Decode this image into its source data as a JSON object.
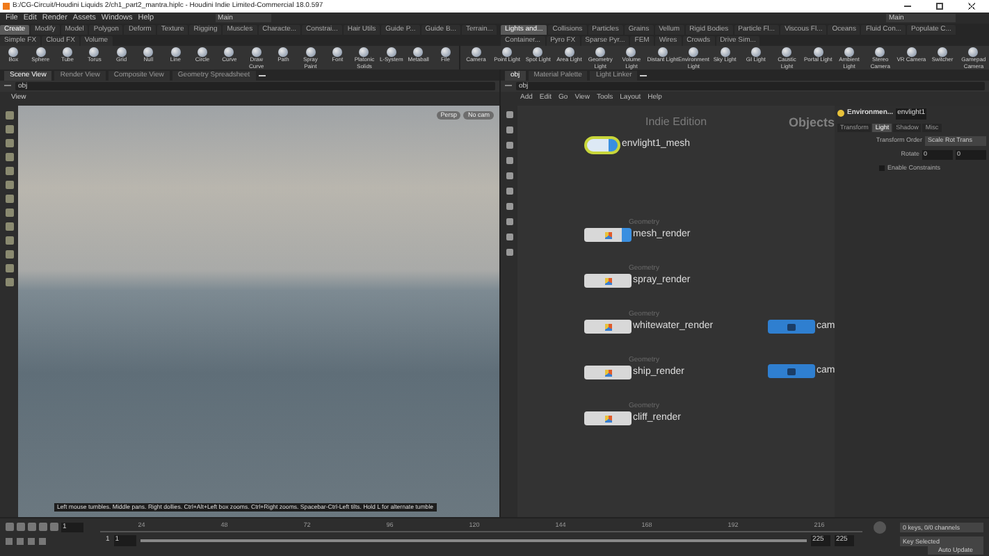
{
  "window": {
    "title": "B:/CG-Circuit/Houdini Liquids 2/ch1_part2_mantra.hiplc - Houdini Indie Limited-Commercial 18.0.597"
  },
  "menu": [
    "File",
    "Edit",
    "Render",
    "Assets",
    "Windows",
    "Help"
  ],
  "desktop": {
    "left": "Main",
    "right": "Main"
  },
  "shelf_tabs_left": [
    {
      "label": "Create",
      "selected": true
    },
    {
      "label": "Modify",
      "selected": false
    },
    {
      "label": "Model",
      "selected": false
    },
    {
      "label": "Polygon",
      "selected": false
    },
    {
      "label": "Deform",
      "selected": false
    },
    {
      "label": "Texture",
      "selected": false
    },
    {
      "label": "Rigging",
      "selected": false
    },
    {
      "label": "Muscles",
      "selected": false
    },
    {
      "label": "Characte...",
      "selected": false
    },
    {
      "label": "Constrai...",
      "selected": false
    },
    {
      "label": "Hair Utils",
      "selected": false
    },
    {
      "label": "Guide P...",
      "selected": false
    },
    {
      "label": "Guide B...",
      "selected": false
    },
    {
      "label": "Terrain...",
      "selected": false
    },
    {
      "label": "Simple FX",
      "selected": false
    },
    {
      "label": "Cloud FX",
      "selected": false
    },
    {
      "label": "Volume",
      "selected": false
    }
  ],
  "shelf_tabs_right": [
    {
      "label": "Lights and...",
      "selected": true
    },
    {
      "label": "Collisions",
      "selected": false
    },
    {
      "label": "Particles",
      "selected": false
    },
    {
      "label": "Grains",
      "selected": false
    },
    {
      "label": "Vellum",
      "selected": false
    },
    {
      "label": "Rigid Bodies",
      "selected": false
    },
    {
      "label": "Particle Fl...",
      "selected": false
    },
    {
      "label": "Viscous Fl...",
      "selected": false
    },
    {
      "label": "Oceans",
      "selected": false
    },
    {
      "label": "Fluid Con...",
      "selected": false
    },
    {
      "label": "Populate C...",
      "selected": false
    },
    {
      "label": "Container...",
      "selected": false
    },
    {
      "label": "Pyro FX",
      "selected": false
    },
    {
      "label": "Sparse Pyr...",
      "selected": false
    },
    {
      "label": "FEM",
      "selected": false
    },
    {
      "label": "Wires",
      "selected": false
    },
    {
      "label": "Crowds",
      "selected": false
    },
    {
      "label": "Drive Sim...",
      "selected": false
    }
  ],
  "tools_left": [
    "Box",
    "Sphere",
    "Tube",
    "Torus",
    "Grid",
    "Null",
    "Line",
    "Circle",
    "Curve",
    "Draw Curve",
    "Path",
    "Spray Paint",
    "Font",
    "Platonic Solids",
    "L-System",
    "Metaball",
    "File"
  ],
  "tools_right": [
    "Camera",
    "Point Light",
    "Spot Light",
    "Area Light",
    "Geometry Light",
    "Volume Light",
    "Distant Light",
    "Environment Light",
    "Sky Light",
    "GI Light",
    "Caustic Light",
    "Portal Light",
    "Ambient Light",
    "Stereo Camera",
    "VR Camera",
    "Switcher",
    "Gamepad Camera"
  ],
  "pane_tabs_left": [
    {
      "label": "Scene View",
      "selected": true
    },
    {
      "label": "Render View",
      "selected": false
    },
    {
      "label": "Composite View",
      "selected": false
    },
    {
      "label": "Geometry Spreadsheet",
      "selected": false
    }
  ],
  "pane_tabs_right": [
    {
      "label": "obj",
      "selected": true
    },
    {
      "label": "Material Palette",
      "selected": false
    },
    {
      "label": "Light Linker",
      "selected": false
    }
  ],
  "path_left": "obj",
  "path_right": "obj",
  "viewport": {
    "label": "View",
    "camera_menus": [
      "Persp",
      "No cam"
    ],
    "hint": "Left mouse tumbles. Middle pans. Right dollies. Ctrl+Alt+Left box zooms. Ctrl+Right zooms. Spacebar-Ctrl-Left tilts. Hold L for alternate tumble"
  },
  "network": {
    "menu": [
      "Add",
      "Edit",
      "Go",
      "View",
      "Tools",
      "Layout",
      "Help"
    ],
    "edition": "Indie Edition",
    "context": "Objects",
    "nodes": [
      {
        "kind": "light",
        "name": "envlight1_mesh",
        "display": true
      },
      {
        "kind": "geometry",
        "type_label": "Geometry",
        "name": "mesh_render",
        "display": true
      },
      {
        "kind": "geometry",
        "type_label": "Geometry",
        "name": "spray_render",
        "display": false
      },
      {
        "kind": "geometry",
        "type_label": "Geometry",
        "name": "whitewater_render",
        "display": false
      },
      {
        "kind": "geometry",
        "type_label": "Geometry",
        "name": "ship_render",
        "display": false
      },
      {
        "kind": "geometry",
        "type_label": "Geometry",
        "name": "cliff_render",
        "display": false
      },
      {
        "kind": "camera",
        "name": "cam",
        "display": false
      },
      {
        "kind": "camera",
        "name": "cam",
        "display": false
      }
    ]
  },
  "parameters": {
    "type": "Environmen...",
    "node": "envlight1",
    "tabs": [
      {
        "label": "Transform",
        "selected": false
      },
      {
        "label": "Light",
        "selected": true
      },
      {
        "label": "Shadow",
        "selected": false
      },
      {
        "label": "Misc",
        "selected": false
      }
    ],
    "transform_order": {
      "label": "Transform Order",
      "value": "Scale Rot Trans"
    },
    "rotate": {
      "label": "Rotate",
      "values": [
        "0",
        "0"
      ]
    },
    "constraints": {
      "label": "Enable Constraints",
      "checked": false
    }
  },
  "timeline": {
    "frame": "1",
    "ticks": [
      "24",
      "48",
      "72",
      "96",
      "120",
      "144",
      "168",
      "192",
      "216"
    ],
    "start": "1",
    "start2": "1",
    "end": "225",
    "end2": "225",
    "range": {
      "level": 1
    },
    "keys": "0 keys, 0/0 channels",
    "key_mode": "Key Selected",
    "update": "Auto Update"
  }
}
